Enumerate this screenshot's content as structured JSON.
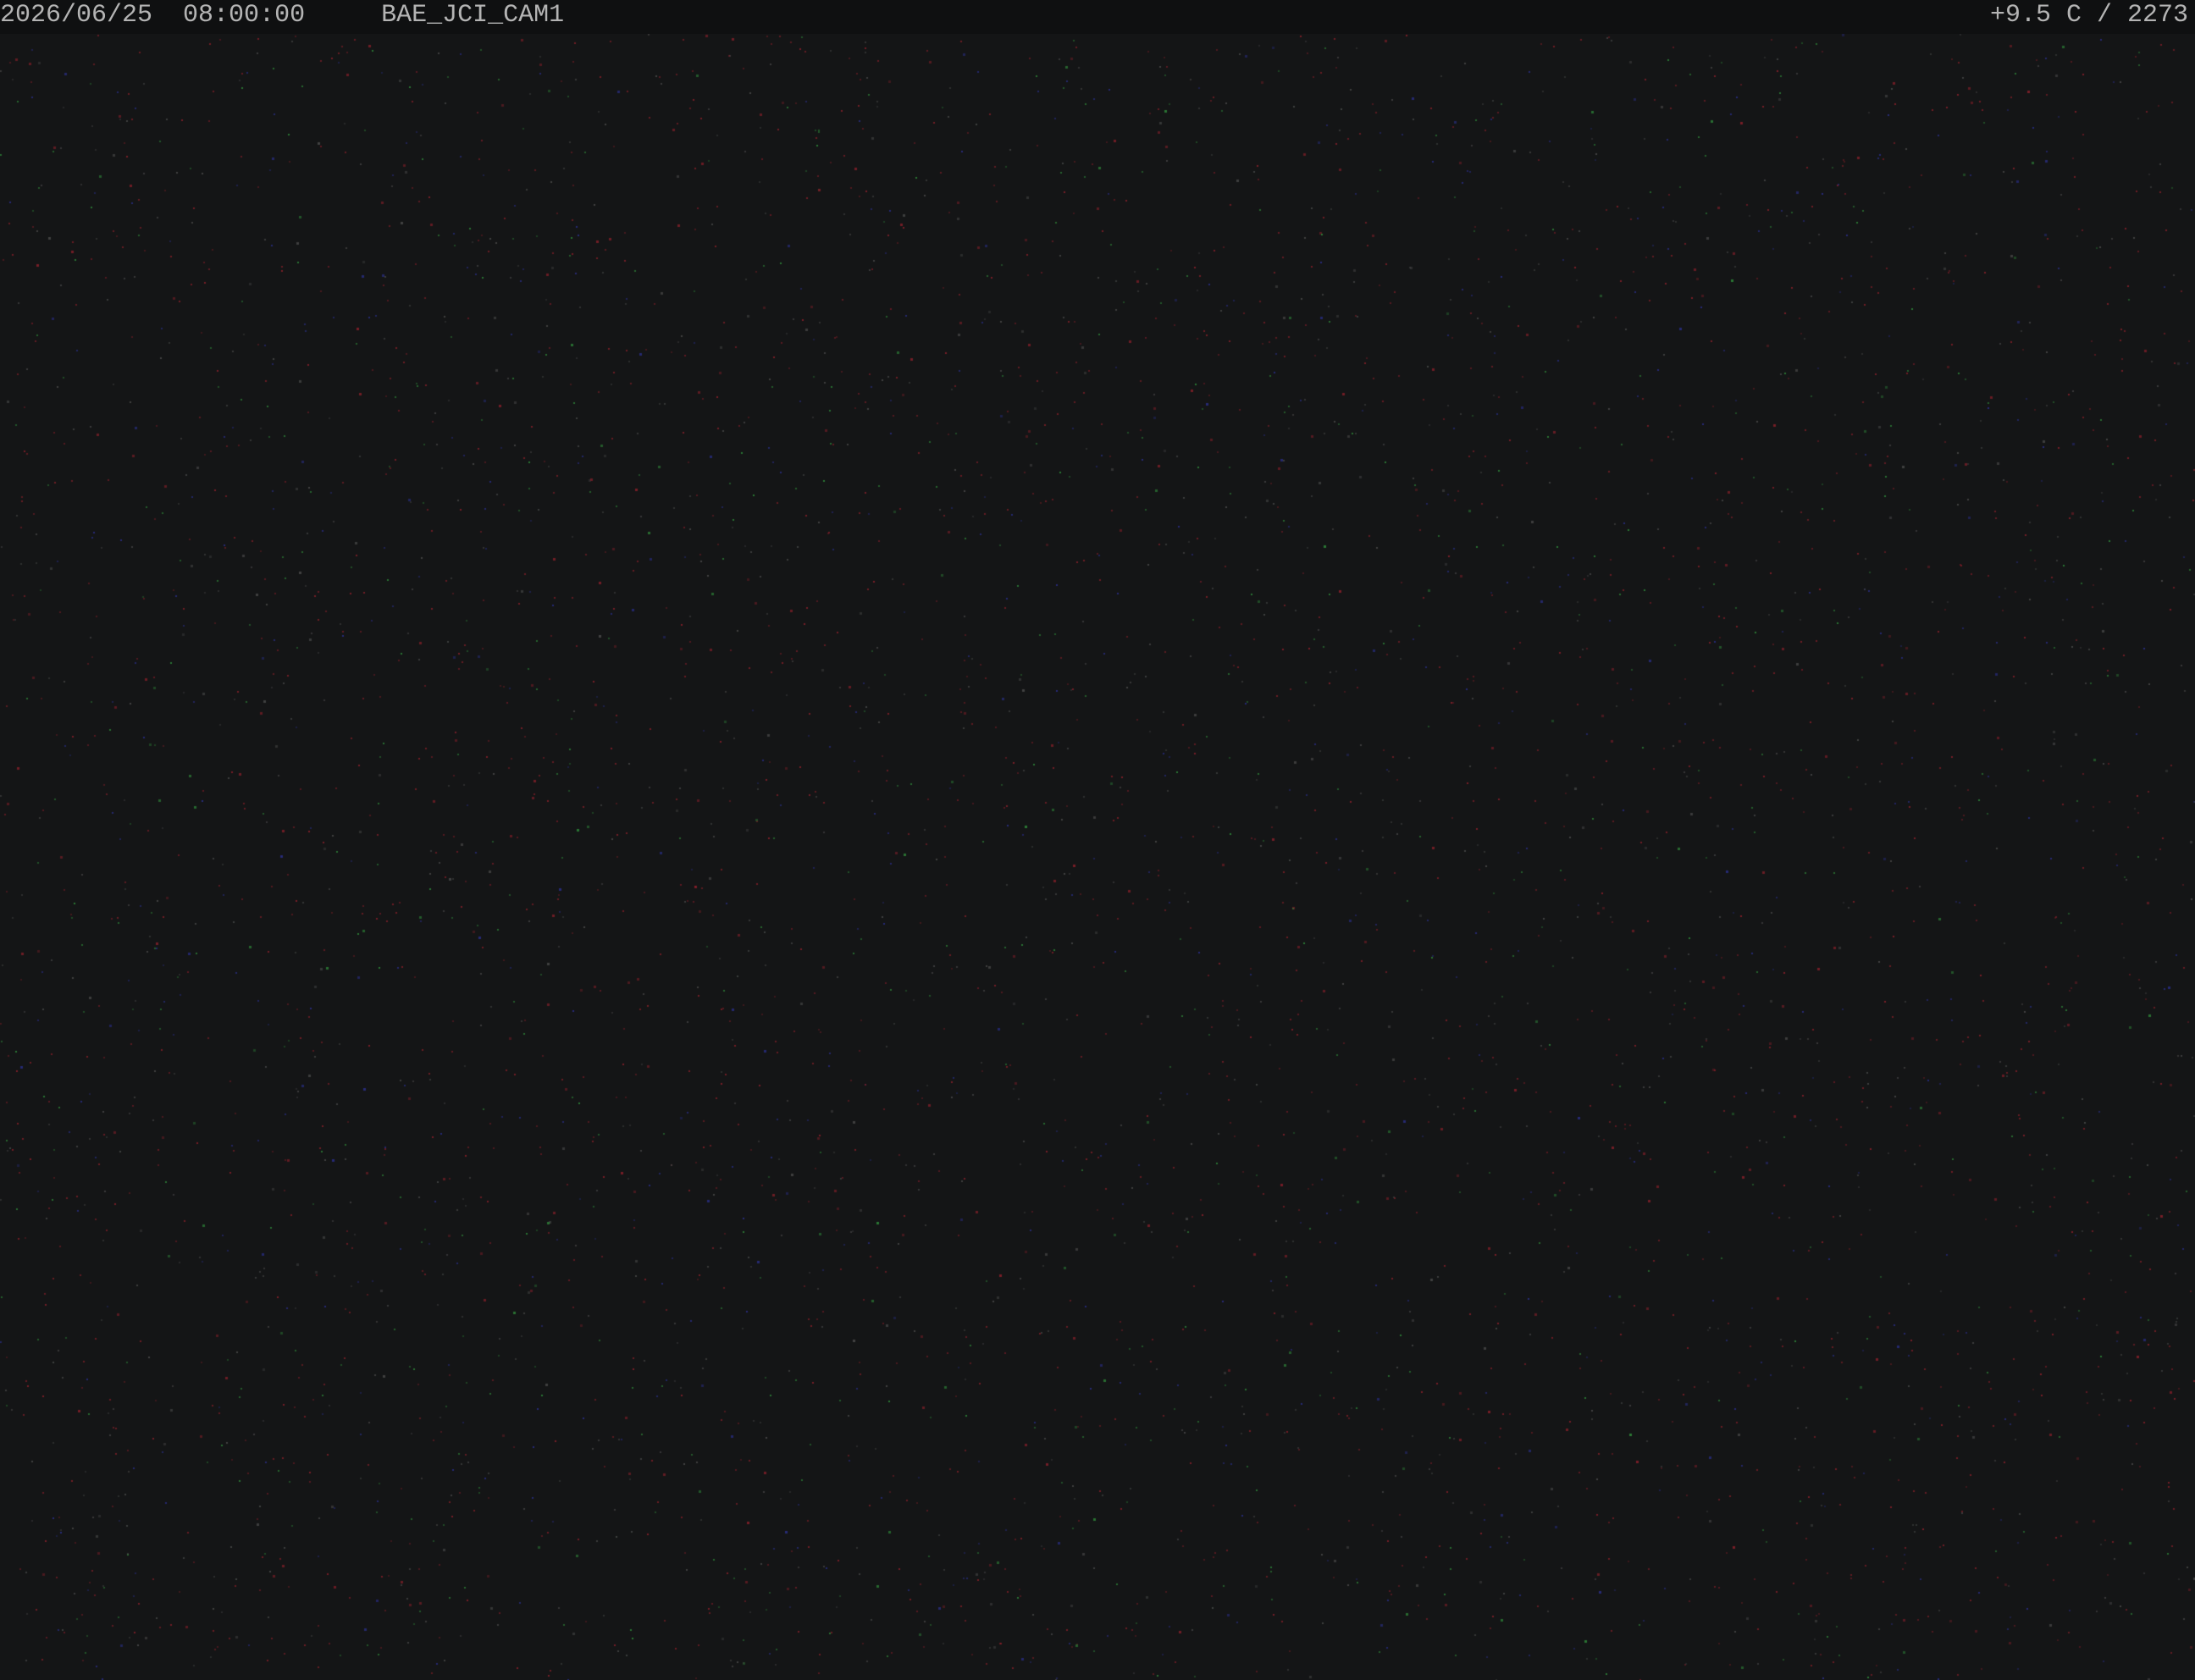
{
  "overlay": {
    "date": "2026/06/25",
    "time": "08:00:00",
    "camera_id": "BAE_JCI_CAM1",
    "temperature": "+9.5 C",
    "counter": "2273"
  },
  "colors": {
    "background": "#141516",
    "overlay_bar": "#0f1011",
    "overlay_text": "#b4b4b4",
    "noise_red": "#8a1f2a",
    "noise_blue": "#2a2f8a",
    "noise_green": "#2f8a3a",
    "noise_gray": "#4a4a4a"
  }
}
